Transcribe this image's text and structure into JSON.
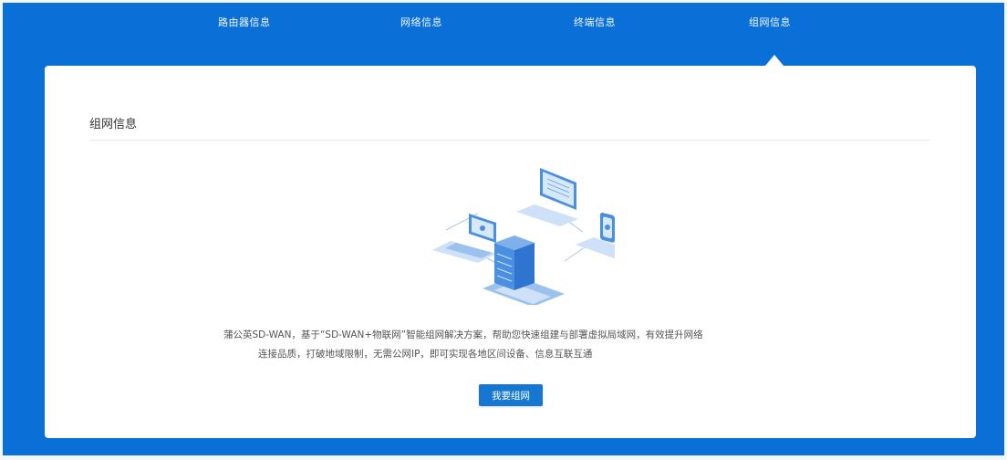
{
  "nav": {
    "tabs": [
      {
        "label": "路由器信息"
      },
      {
        "label": "网络信息"
      },
      {
        "label": "终端信息"
      },
      {
        "label": "组网信息"
      }
    ],
    "active_index": 3
  },
  "main": {
    "section_title": "组网信息",
    "description_line1": "蒲公英SD-WAN，基于“SD-WAN+物联网”智能组网解决方案，帮助您快速组建与部署虚拟局域网，有效提升网络",
    "description_line2": "连接品质，打破地域限制，无需公网IP，即可实现各地区间设备、信息互联互通",
    "cta_label": "我要组网"
  },
  "colors": {
    "accent": "#0a6fd6",
    "button": "#1677d2"
  },
  "icons": [
    "desktop-monitor-icon",
    "laptop-icon",
    "mobile-phone-icon",
    "server-icon"
  ]
}
